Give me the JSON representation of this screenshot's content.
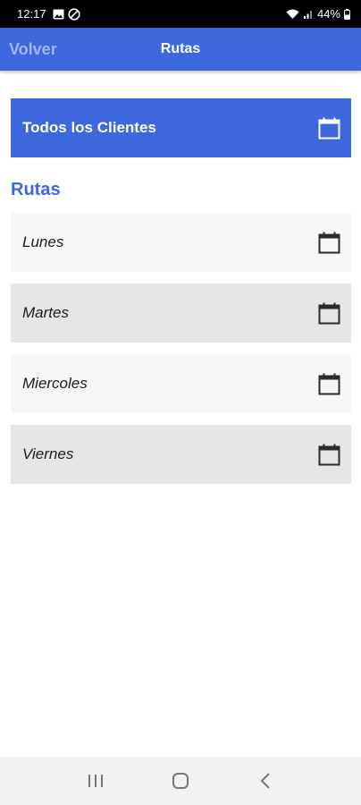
{
  "status_bar": {
    "time": "12:17",
    "battery": "44%",
    "icons": [
      "gallery-icon",
      "do-not-disturb-icon",
      "wifi-icon",
      "signal-icon",
      "battery-icon"
    ]
  },
  "app_bar": {
    "back_label": "Volver",
    "title": "Rutas"
  },
  "all_clients": {
    "label": "Todos los Clientes",
    "icon": "calendar-icon"
  },
  "routes_section": {
    "title": "Rutas",
    "items": [
      {
        "label": "Lunes",
        "icon": "calendar-icon"
      },
      {
        "label": "Martes",
        "icon": "calendar-icon"
      },
      {
        "label": "Miercoles",
        "icon": "calendar-icon"
      },
      {
        "label": "Viernes",
        "icon": "calendar-icon"
      }
    ]
  },
  "nav_bar": {
    "icons": [
      "recent-apps-icon",
      "home-icon",
      "back-icon"
    ]
  },
  "colors": {
    "primary": "#3d67dc",
    "back_label": "#9fb6f0",
    "row_light": "#f6f6f6",
    "row_dark": "#e6e6e6"
  }
}
